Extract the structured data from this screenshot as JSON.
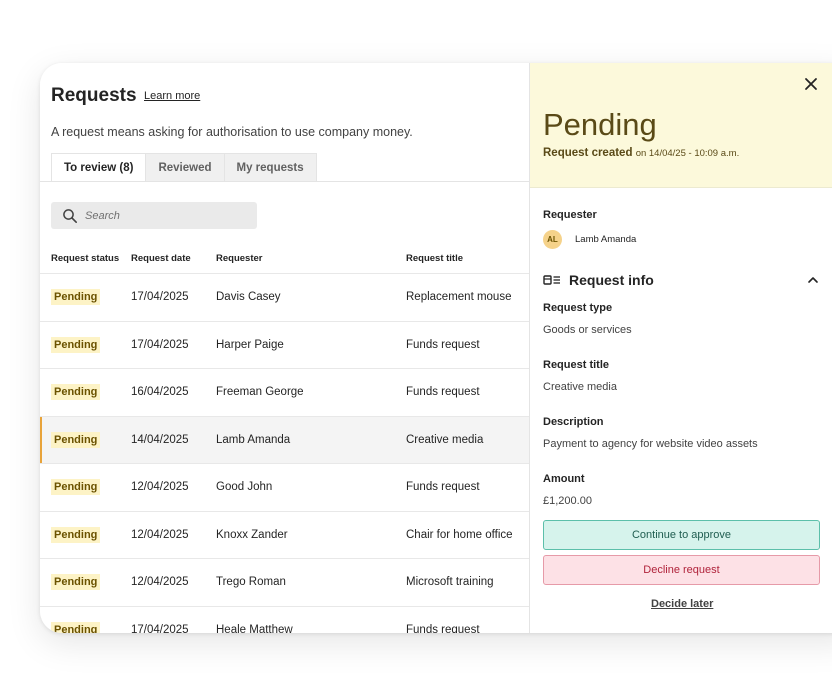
{
  "header": {
    "title": "Requests",
    "learn_more": "Learn more",
    "subtitle": "A request means asking for authorisation to use company money."
  },
  "tabs": [
    {
      "label": "To review (8)",
      "active": true
    },
    {
      "label": "Reviewed"
    },
    {
      "label": "My requests"
    }
  ],
  "search": {
    "placeholder": "Search"
  },
  "table": {
    "columns": [
      "Request status",
      "Request date",
      "Requester",
      "Request title"
    ],
    "rows": [
      {
        "status": "Pending",
        "date": "17/04/2025",
        "requester": "Davis Casey",
        "title": "Replacement mouse"
      },
      {
        "status": "Pending",
        "date": "17/04/2025",
        "requester": "Harper Paige",
        "title": "Funds request"
      },
      {
        "status": "Pending",
        "date": "16/04/2025",
        "requester": "Freeman George",
        "title": "Funds request"
      },
      {
        "status": "Pending",
        "date": "14/04/2025",
        "requester": "Lamb Amanda",
        "title": "Creative media",
        "selected": true
      },
      {
        "status": "Pending",
        "date": "12/04/2025",
        "requester": "Good John",
        "title": "Funds request"
      },
      {
        "status": "Pending",
        "date": "12/04/2025",
        "requester": "Knoxx Zander",
        "title": "Chair for home office"
      },
      {
        "status": "Pending",
        "date": "12/04/2025",
        "requester": "Trego Roman",
        "title": "Microsoft training"
      },
      {
        "status": "Pending",
        "date": "17/04/2025",
        "requester": "Heale Matthew",
        "title": "Funds request"
      }
    ]
  },
  "detail": {
    "status": "Pending",
    "created_label": "Request created",
    "created_date": "on 14/04/25 - 10:09 a.m.",
    "requester_label": "Requester",
    "requester_initials": "AL",
    "requester_name": "Lamb Amanda",
    "section_title": "Request info",
    "type_label": "Request type",
    "type_value": "Goods or services",
    "title_label": "Request title",
    "title_value": "Creative media",
    "description_label": "Description",
    "description_value": "Payment to agency for website video assets",
    "amount_label": "Amount",
    "amount_value": "£1,200.00",
    "approve_label": "Continue to approve",
    "decline_label": "Decline request",
    "decide_later_label": "Decide later"
  },
  "colors": {
    "pending_badge_bg": "#fdf3c6",
    "status_header_bg": "#fcf9db",
    "selected_accent": "#e8a33a",
    "approve_bg": "#d6f3ec",
    "decline_bg": "#fde1e6"
  },
  "icons": [
    "search-icon",
    "close-icon",
    "info-card-icon",
    "chevron-up-icon"
  ]
}
